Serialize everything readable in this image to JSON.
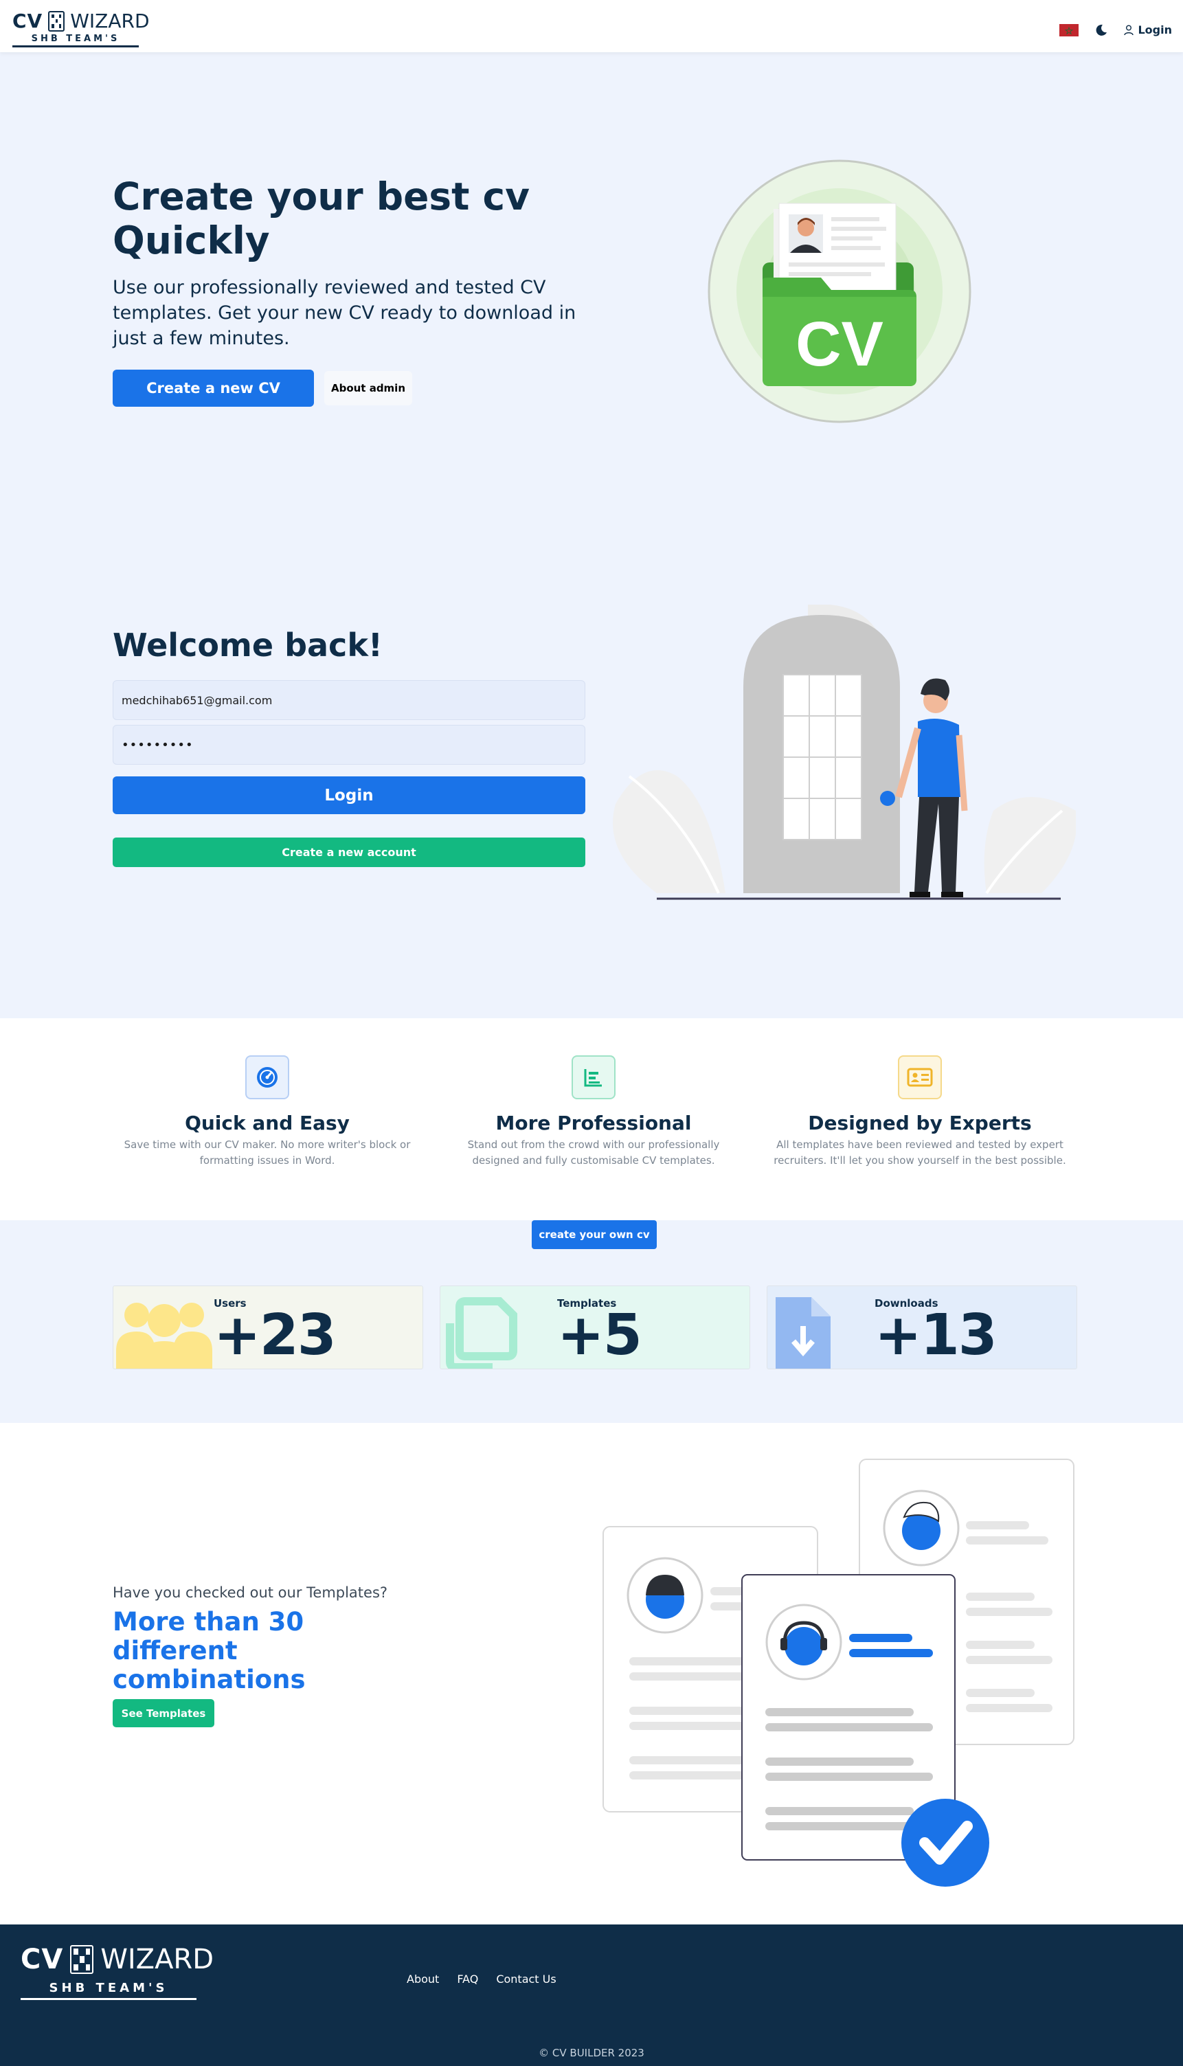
{
  "brand": {
    "cv": "CV",
    "wizard": "WIZARD",
    "team": "SHB TEAM'S"
  },
  "nav": {
    "login_label": "Login",
    "flag_color": "#c1272d"
  },
  "hero": {
    "title": "Create your best cv Quickly",
    "description": "Use our professionally reviewed and tested CV templates. Get your new CV ready to download in just a few minutes.",
    "create_button": "Create a new CV",
    "admin_button": "About admin",
    "art_label": "CV"
  },
  "login": {
    "title": "Welcome back!",
    "email_value": "medchihab651@gmail.com",
    "password_value": "•••••••••",
    "login_button": "Login",
    "create_account_button": "Create a new account"
  },
  "features": [
    {
      "title": "Quick and Easy",
      "description": "Save time with our CV maker. No more writer's block or formatting issues in Word.",
      "icon": "speedometer-icon",
      "color": "#1a73e8"
    },
    {
      "title": "More Professional",
      "description": "Stand out from the crowd with our professionally designed and fully customisable CV templates.",
      "icon": "chart-icon",
      "color": "#13b981"
    },
    {
      "title": "Designed by Experts",
      "description": "All templates have been reviewed and tested by expert recruiters. It'll let you show yourself in the best possible.",
      "icon": "id-card-icon",
      "color": "#f0b429"
    }
  ],
  "cta": {
    "own_cv_button": "create your own cv"
  },
  "stats": [
    {
      "label": "Users",
      "value": "+23",
      "icon": "users-icon"
    },
    {
      "label": "Templates",
      "value": "+5",
      "icon": "copy-icon"
    },
    {
      "label": "Downloads",
      "value": "+13",
      "icon": "file-download-icon"
    }
  ],
  "templates": {
    "question": "Have you checked out our Templates?",
    "headline": "More than 30 different combinations",
    "see_button": "See Templates"
  },
  "footer": {
    "links": [
      "About",
      "FAQ",
      "Contact Us"
    ],
    "copyright": "© CV BUILDER 2023"
  }
}
